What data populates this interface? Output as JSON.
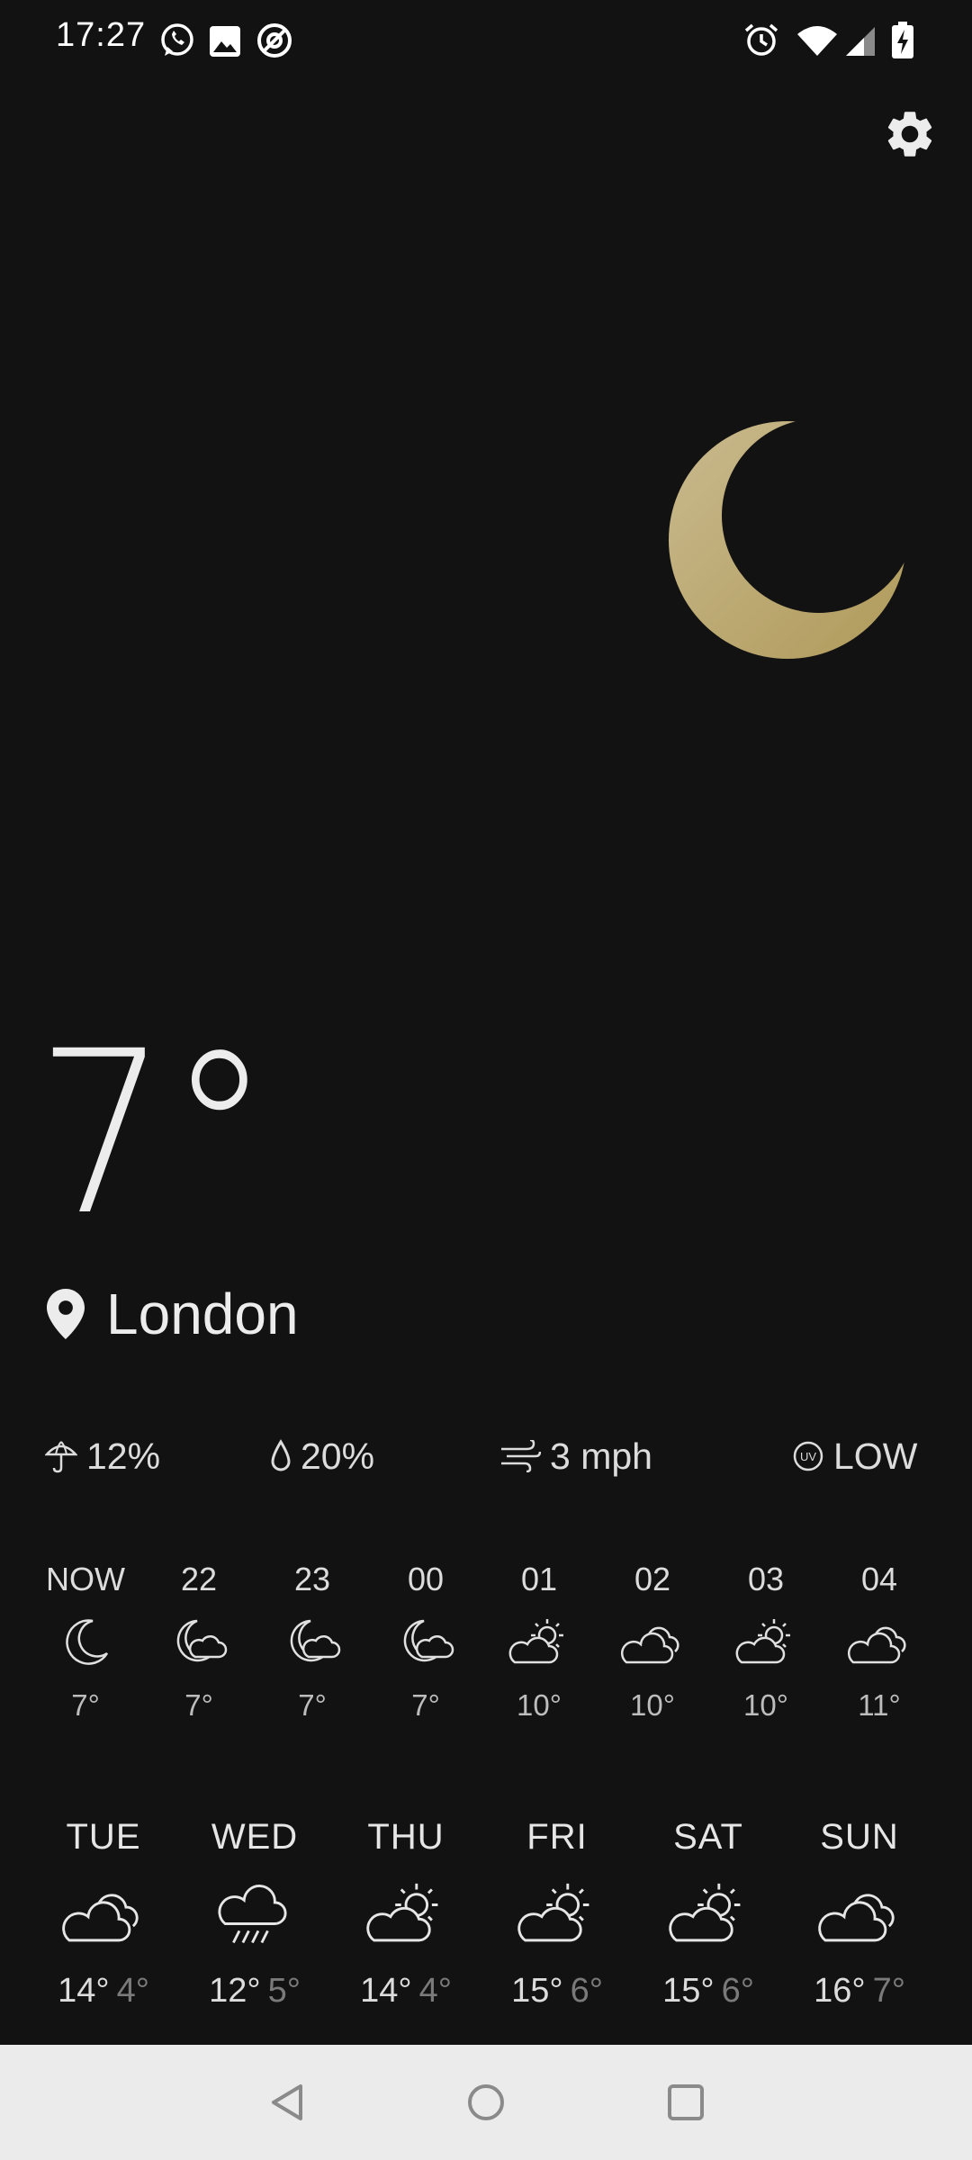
{
  "status_bar": {
    "time": "17:27",
    "left_icons": [
      "whatsapp-icon",
      "gallery-icon",
      "blocked-app-icon"
    ],
    "right_icons": [
      "alarm-icon",
      "wifi-icon",
      "cellular-signal-icon",
      "battery-charging-icon"
    ]
  },
  "toolbar": {
    "settings_icon": "gear-icon"
  },
  "current": {
    "condition_icon": "moon-icon",
    "temperature": "7°",
    "location": "London"
  },
  "stats": {
    "precipitation_chance": "12%",
    "humidity": "20%",
    "wind": "3 mph",
    "uv": "LOW"
  },
  "hourly": [
    {
      "time": "NOW",
      "icon": "moon-icon",
      "temp": "7°"
    },
    {
      "time": "22",
      "icon": "night-cloudy-icon",
      "temp": "7°"
    },
    {
      "time": "23",
      "icon": "night-cloudy-icon",
      "temp": "7°"
    },
    {
      "time": "00",
      "icon": "night-cloudy-icon",
      "temp": "7°"
    },
    {
      "time": "01",
      "icon": "partly-sunny-icon",
      "temp": "10°"
    },
    {
      "time": "02",
      "icon": "cloudy-icon",
      "temp": "10°"
    },
    {
      "time": "03",
      "icon": "partly-sunny-icon",
      "temp": "10°"
    },
    {
      "time": "04",
      "icon": "cloudy-icon",
      "temp": "11°"
    }
  ],
  "daily": [
    {
      "day": "TUE",
      "icon": "cloudy-icon",
      "high": "14°",
      "low": "4°"
    },
    {
      "day": "WED",
      "icon": "rain-icon",
      "high": "12°",
      "low": "5°"
    },
    {
      "day": "THU",
      "icon": "partly-sunny-icon",
      "high": "14°",
      "low": "4°"
    },
    {
      "day": "FRI",
      "icon": "partly-sunny-icon",
      "high": "15°",
      "low": "6°"
    },
    {
      "day": "SAT",
      "icon": "partly-sunny-icon",
      "high": "15°",
      "low": "6°"
    },
    {
      "day": "SUN",
      "icon": "cloudy-icon",
      "high": "16°",
      "low": "7°"
    }
  ],
  "colors": {
    "background": "#121212",
    "text": "#ececec",
    "moon_gold": "#b7a26a",
    "low_temp": "#7a7a7a",
    "nav_bar": "#ebebeb"
  }
}
